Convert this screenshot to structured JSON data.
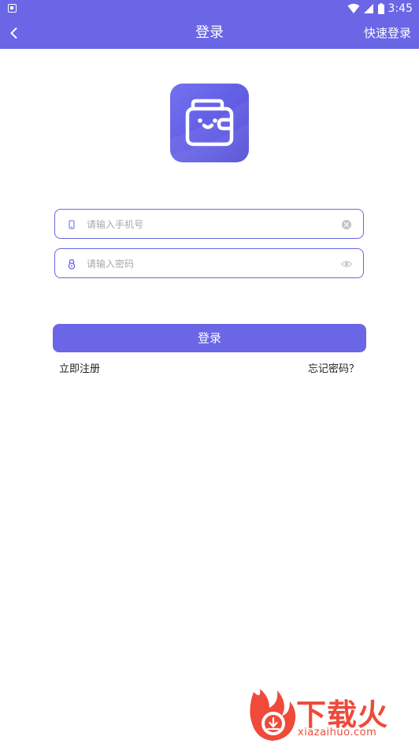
{
  "status_bar": {
    "time": "3:45",
    "icons": [
      "notification-icon",
      "wifi-icon",
      "signal-icon",
      "battery-icon"
    ]
  },
  "header": {
    "title": "登录",
    "right_action": "快速登录",
    "back_icon": "chevron-left-icon",
    "background": "#6a66e6"
  },
  "logo": {
    "icon": "wallet-smile-icon"
  },
  "form": {
    "phone": {
      "placeholder": "请输入手机号",
      "value": "",
      "lead_icon": "phone-icon",
      "trail_icon": "clear-icon"
    },
    "password": {
      "placeholder": "请输入密码",
      "value": "",
      "lead_icon": "lock-icon",
      "trail_icon": "eye-icon"
    },
    "submit_label": "登录",
    "register_link": "立即注册",
    "forgot_link": "忘记密码？"
  },
  "watermark": {
    "brand": "下载火",
    "domain": "xiazaihuo.com"
  },
  "colors": {
    "accent": "#6a66e6",
    "watermark": "#ef4a3a"
  }
}
